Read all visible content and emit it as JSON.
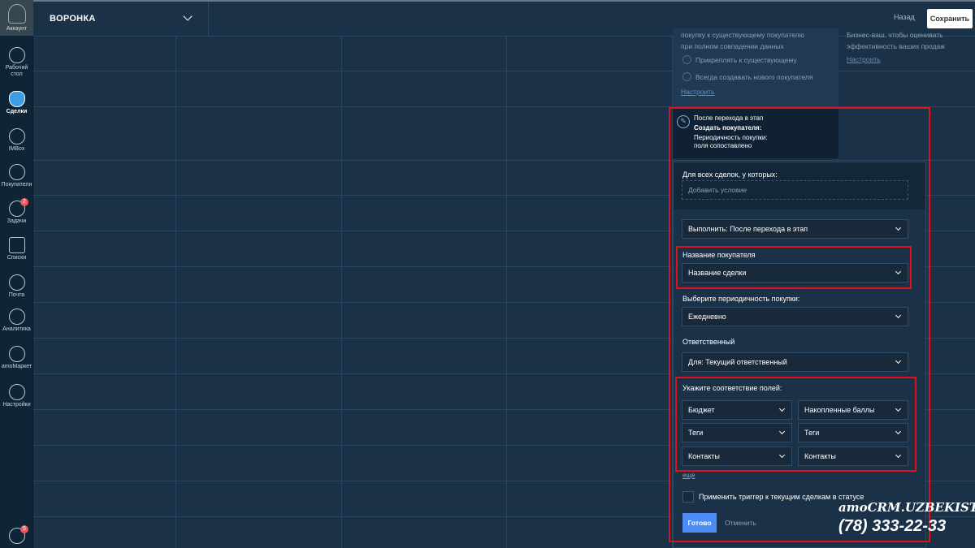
{
  "nav": {
    "account": "Аккаунт",
    "items": [
      {
        "label": "Рабочий стол",
        "icon": "dashboard-icon"
      },
      {
        "label": "Сделки",
        "icon": "leads-icon"
      },
      {
        "label": "IMBox",
        "icon": "chat-icon"
      },
      {
        "label": "Покупатели",
        "icon": "customers-icon"
      },
      {
        "label": "Задачи",
        "icon": "tasks-icon",
        "badge": "2"
      },
      {
        "label": "Списки",
        "icon": "lists-icon"
      },
      {
        "label": "Почта",
        "icon": "mail-icon"
      },
      {
        "label": "Аналитика",
        "icon": "analytics-icon"
      },
      {
        "label": "amoМаркет",
        "icon": "market-icon"
      },
      {
        "label": "Настройки",
        "icon": "settings-icon"
      }
    ],
    "notifications_badge": "5"
  },
  "topbar": {
    "funnel_title": "ВОРОНКА",
    "back_label": "Назад",
    "save_label": "Сохранить"
  },
  "bg_card": {
    "line1": "покупку к существующему покупателю",
    "line2": "при полном совпадении данных",
    "opt1": "Прикреплять к существующему",
    "opt2": "Всегда создавать нового покупателя",
    "link": "Настроить"
  },
  "bg_card2": {
    "line1": "Бизнес-ваш, чтобы оценивать",
    "line2": "эффективность ваших продаж",
    "link": "Настроить"
  },
  "trigger": {
    "line1": "После перехода в этап",
    "line2": "Создать покупателя:",
    "line3": "Периодичность покупки:",
    "line4": "поля сопоставлено"
  },
  "panel": {
    "cond_label": "Для всех сделок, у которых:",
    "add_condition": "Добавить условие",
    "execute_value": "Выполнить: После перехода в этап",
    "name_label": "Название покупателя",
    "name_value": "Название сделки",
    "period_label": "Выберите периодичность покупки:",
    "period_value": "Ежедневно",
    "resp_label": "Ответственный",
    "resp_value": "Для: Текущий ответственный",
    "map_label": "Укажите соответствие полей:",
    "map_rows": [
      {
        "left": "Бюджет",
        "right": "Накопленные баллы"
      },
      {
        "left": "Теги",
        "right": "Теги"
      },
      {
        "left": "Контакты",
        "right": "Контакты"
      }
    ],
    "more": "еще",
    "apply_label": "Применить триггер к текущим сделкам в статусе",
    "done": "Готово",
    "cancel": "Отменить"
  },
  "watermark": {
    "brand": "amoCRM.UZBEKISTAN",
    "phone": "(78) 333-22-33"
  }
}
